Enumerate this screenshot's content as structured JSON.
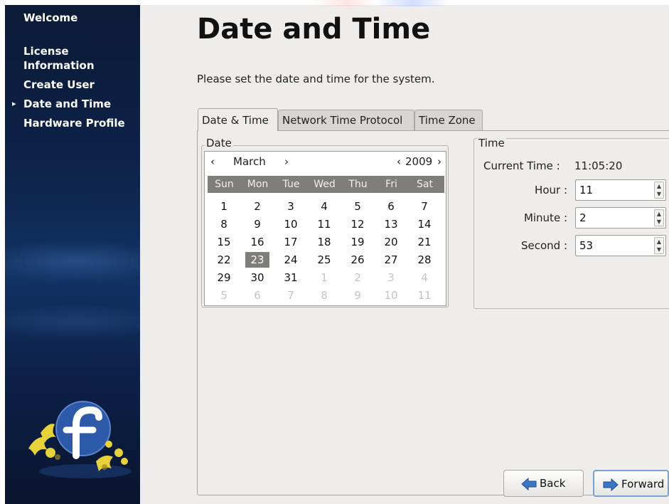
{
  "sidebar": {
    "items": [
      {
        "label": "Welcome",
        "active": false
      },
      {
        "label": "License\nInformation",
        "active": false
      },
      {
        "label": "Create User",
        "active": false
      },
      {
        "label": "Date and Time",
        "active": true
      },
      {
        "label": "Hardware Profile",
        "active": false
      }
    ],
    "logo_icon": "fedora-logo"
  },
  "page": {
    "title": "Date and Time",
    "subtitle": "Please set the date and time for the system."
  },
  "tabs": [
    {
      "label": "Date & Time",
      "active": true
    },
    {
      "label": "Network Time Protocol",
      "active": false
    },
    {
      "label": "Time Zone",
      "active": false
    }
  ],
  "date": {
    "frame_label": "Date",
    "month": "March",
    "year": "2009",
    "prev_month_symbol": "‹",
    "next_month_symbol": "›",
    "prev_year_symbol": "‹",
    "next_year_symbol": "›",
    "weekdays": [
      "Sun",
      "Mon",
      "Tue",
      "Wed",
      "Thu",
      "Fri",
      "Sat"
    ],
    "weeks": [
      [
        "1",
        "2",
        "3",
        "4",
        "5",
        "6",
        "7"
      ],
      [
        "8",
        "9",
        "10",
        "11",
        "12",
        "13",
        "14"
      ],
      [
        "15",
        "16",
        "17",
        "18",
        "19",
        "20",
        "21"
      ],
      [
        "22",
        "23",
        "24",
        "25",
        "26",
        "27",
        "28"
      ],
      [
        "29",
        "30",
        "31",
        "1",
        "2",
        "3",
        "4"
      ],
      [
        "5",
        "6",
        "7",
        "8",
        "9",
        "10",
        "11"
      ]
    ],
    "selected_day": "23"
  },
  "time": {
    "frame_label": "Time",
    "current_time_label": "Current Time :",
    "current_time_value": "11:05:20",
    "hour_label": "Hour :",
    "hour_value": "11",
    "minute_label": "Minute :",
    "minute_value": "2",
    "second_label": "Second :",
    "second_value": "53"
  },
  "buttons": {
    "back_label": "Back",
    "forward_label": "Forward"
  },
  "colors": {
    "sidebar_bg": "#0d2248",
    "selected_day_bg": "#7f7e7b",
    "button_arrow": "#3a76c2"
  }
}
